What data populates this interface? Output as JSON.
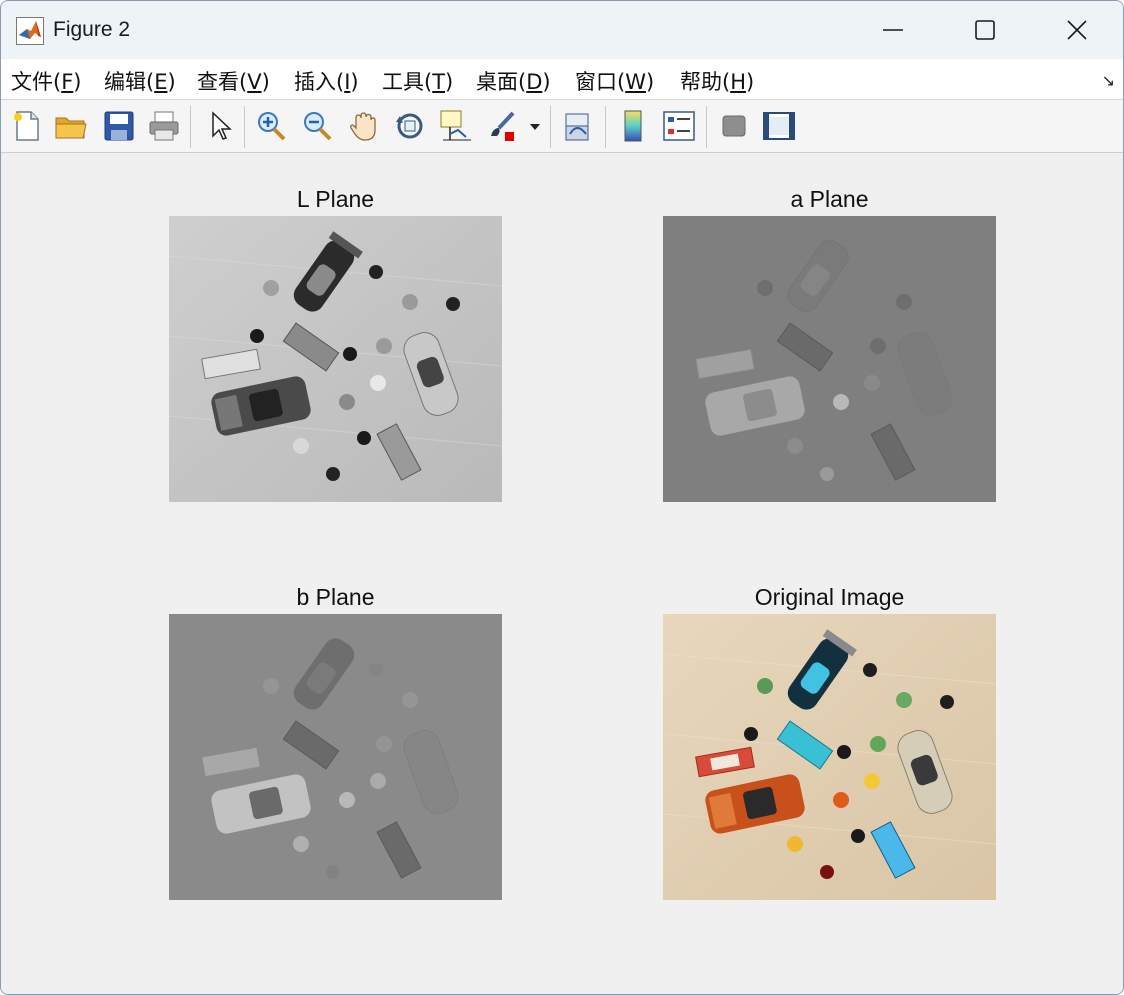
{
  "window": {
    "title": "Figure 2"
  },
  "menu": {
    "items": [
      {
        "label": "文件(",
        "key": "F",
        "end": ")"
      },
      {
        "label": "编辑(",
        "key": "E",
        "end": ")"
      },
      {
        "label": "查看(",
        "key": "V",
        "end": ")"
      },
      {
        "label": "插入(",
        "key": "I",
        "end": ")"
      },
      {
        "label": "工具(",
        "key": "T",
        "end": ")"
      },
      {
        "label": "桌面(",
        "key": "D",
        "end": ")"
      },
      {
        "label": "窗口(",
        "key": "W",
        "end": ")"
      },
      {
        "label": "帮助(",
        "key": "H",
        "end": ")"
      }
    ]
  },
  "toolbar": {
    "icons": [
      "new-figure-icon",
      "open-folder-icon",
      "save-icon",
      "print-icon",
      "select-arrow-icon",
      "zoom-in-icon",
      "zoom-out-icon",
      "pan-hand-icon",
      "rotate-3d-icon",
      "data-cursor-icon",
      "brush-icon",
      "link-plot-icon",
      "colorbar-icon",
      "legend-icon",
      "hide-plot-tools-icon",
      "show-plot-tools-icon"
    ]
  },
  "subplots": [
    {
      "title": "L Plane"
    },
    {
      "title": "a Plane"
    },
    {
      "title": "b Plane"
    },
    {
      "title": "Original Image"
    }
  ],
  "colors": {
    "background": "#f0f0f0",
    "l_plane_bg": "#c9c9c9",
    "a_plane_bg": "#7e7e7e",
    "b_plane_bg": "#8a8a8a",
    "original_bg": "#e3d2b8"
  }
}
